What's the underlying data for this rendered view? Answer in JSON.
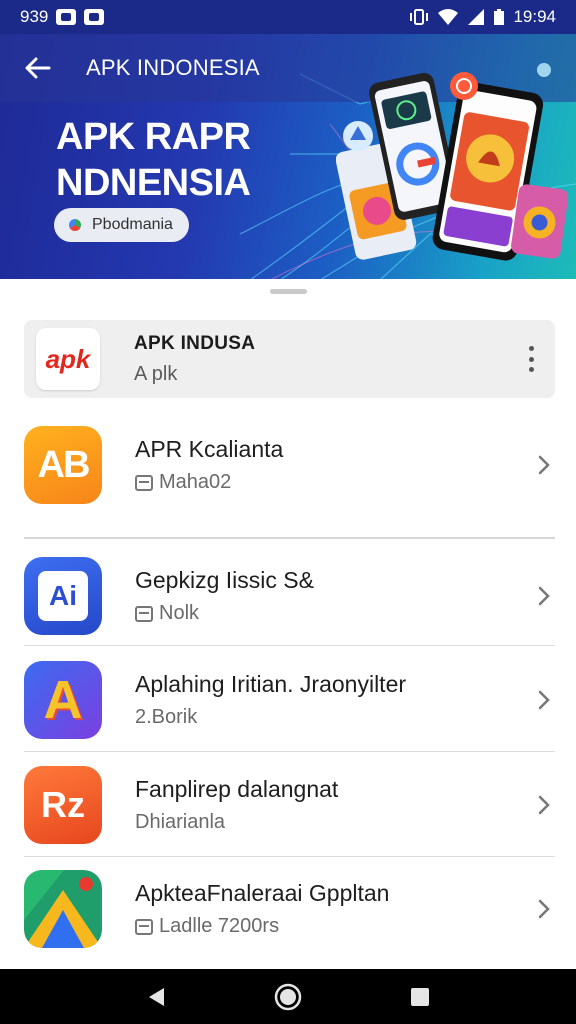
{
  "status_bar": {
    "time_left": "939",
    "time_right": "19:94",
    "icons": [
      "notification-icon",
      "notification-icon",
      "vibrate-icon",
      "wifi-icon",
      "signal-icon",
      "battery-icon"
    ]
  },
  "app_bar": {
    "title": "APK INDONESIA",
    "back_icon": "arrow-back-icon"
  },
  "banner": {
    "title_line1": "APK RAPR",
    "title_line2": "NDNENSIA",
    "chip_label": "Pbodmania"
  },
  "featured": {
    "name": "APK INDUSA",
    "subtitle": "A plk",
    "icon_text": "apk"
  },
  "apps": [
    {
      "name": "APR Kcalianta",
      "subtitle": "Maha02",
      "icon_text": "AB"
    },
    {
      "name": "Gepkizg Iissic S&",
      "subtitle": "Nolk",
      "icon_text": "Ai"
    },
    {
      "name": "Aplahing Iritian. Jraonyilter",
      "subtitle": "2.Borik",
      "icon_text": "A"
    },
    {
      "name": "Fanplirep dalangnat",
      "subtitle": "Dhiarianla",
      "icon_text": "Rz"
    },
    {
      "name": "ApkteaFnaleraai Gppltan",
      "subtitle": "Ladlle 7200rs",
      "icon_text": ""
    }
  ],
  "colors": {
    "banner_start": "#1e2a96",
    "banner_end": "#1dbbb8",
    "accent_orange": "#f7a21d"
  }
}
